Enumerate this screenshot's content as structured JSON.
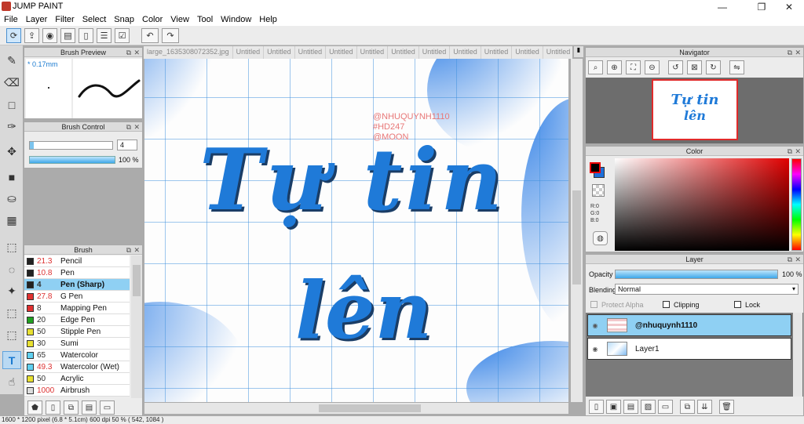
{
  "app": {
    "title": "JUMP PAINT",
    "win": {
      "min": "—",
      "max": "❐",
      "close": "✕"
    }
  },
  "menu": [
    "File",
    "Layer",
    "Filter",
    "Select",
    "Snap",
    "Color",
    "View",
    "Tool",
    "Window",
    "Help"
  ],
  "toolbar": {
    "icons": [
      "cursor-icon",
      "export-icon",
      "comment-icon",
      "message-icon",
      "page-icon",
      "list-icon",
      "checklist-icon"
    ],
    "undo": "↶",
    "redo": "↷"
  },
  "tools": [
    {
      "name": "brush-tool-icon",
      "glyph": "✎"
    },
    {
      "name": "eraser-tool-icon",
      "glyph": "⌫"
    },
    {
      "name": "rectangle-tool-icon",
      "glyph": "□"
    },
    {
      "name": "pen-tool-icon",
      "glyph": "✑"
    },
    {
      "name": "move-tool-icon",
      "glyph": "✥"
    },
    {
      "name": "fill-shape-tool-icon",
      "glyph": "■"
    },
    {
      "name": "bucket-tool-icon",
      "glyph": "⛀"
    },
    {
      "name": "gradient-tool-icon",
      "glyph": "▦"
    },
    {
      "name": "select-rect-tool-icon",
      "glyph": "⬚"
    },
    {
      "name": "lasso-tool-icon",
      "glyph": "◌"
    },
    {
      "name": "magic-wand-tool-icon",
      "glyph": "✦"
    },
    {
      "name": "select-pen-tool-icon",
      "glyph": "⬚"
    },
    {
      "name": "select-eraser-tool-icon",
      "glyph": "⬚"
    },
    {
      "name": "text-tool-icon",
      "glyph": "T"
    },
    {
      "name": "hand-tool-icon",
      "glyph": "☝"
    }
  ],
  "brush_preview": {
    "title": "Brush Preview",
    "size": "* 0.17mm"
  },
  "brush_control": {
    "title": "Brush Control",
    "size_value": "4",
    "opacity_value": "100 %"
  },
  "brush": {
    "title": "Brush",
    "items": [
      {
        "size": "21.3",
        "label": "Pencil",
        "color": "#222222",
        "red": true
      },
      {
        "size": "10.8",
        "label": "Pen",
        "color": "#222222",
        "red": true
      },
      {
        "size": "4",
        "label": "Pen (Sharp)",
        "color": "#222222",
        "red": true,
        "selected": true
      },
      {
        "size": "27.8",
        "label": "G Pen",
        "color": "#e03030",
        "red": true
      },
      {
        "size": "8",
        "label": "Mapping Pen",
        "color": "#e03030",
        "red": false
      },
      {
        "size": "20",
        "label": "Edge Pen",
        "color": "#20a020",
        "red": false
      },
      {
        "size": "50",
        "label": "Stipple Pen",
        "color": "#e8e030",
        "red": false
      },
      {
        "size": "30",
        "label": "Sumi",
        "color": "#e8e030",
        "red": false
      },
      {
        "size": "65",
        "label": "Watercolor",
        "color": "#60d0f0",
        "red": false
      },
      {
        "size": "49.3",
        "label": "Watercolor (Wet)",
        "color": "#60d0f0",
        "red": true
      },
      {
        "size": "50",
        "label": "Acrylic",
        "color": "#e8e030",
        "red": false
      },
      {
        "size": "1000",
        "label": "Airbrush",
        "color": "#dddddd",
        "red": true
      }
    ]
  },
  "tabs": [
    "large_1635308072352.jpg",
    "Untitled",
    "Untitled",
    "Untitled",
    "Untitled",
    "Untitled",
    "Untitled",
    "Untitled",
    "Untitled",
    "Untitled",
    "Untitled",
    "Untitled",
    "Untitled",
    "Untitled"
  ],
  "canvas": {
    "line1": "Tự tin",
    "line2": "lên",
    "watermark": [
      "@NHUQUYNH1110",
      "#HD247",
      "@MOON"
    ]
  },
  "navigator": {
    "title": "Navigator",
    "thumb_line1": "Tự tin",
    "thumb_line2": "lên"
  },
  "color": {
    "title": "Color",
    "r": "R:0",
    "g": "G:0",
    "b": "B:0",
    "fg": "#000000",
    "bg": "#1e6fd9"
  },
  "layer": {
    "title": "Layer",
    "opacity_label": "Opacity",
    "opacity_value": "100 %",
    "opacity": 1.0,
    "blending_label": "Blending",
    "blending_value": "Normal",
    "protect_alpha": "Protect Alpha",
    "clipping": "Clipping",
    "lock": "Lock",
    "items": [
      {
        "name": "@nhuquynh1110",
        "selected": true
      },
      {
        "name": "Layer1",
        "selected": false
      }
    ]
  },
  "status": "1600 * 1200 pixel  (6.8 * 5.1cm)  600 dpi  50 %  ( 542, 1084 )"
}
